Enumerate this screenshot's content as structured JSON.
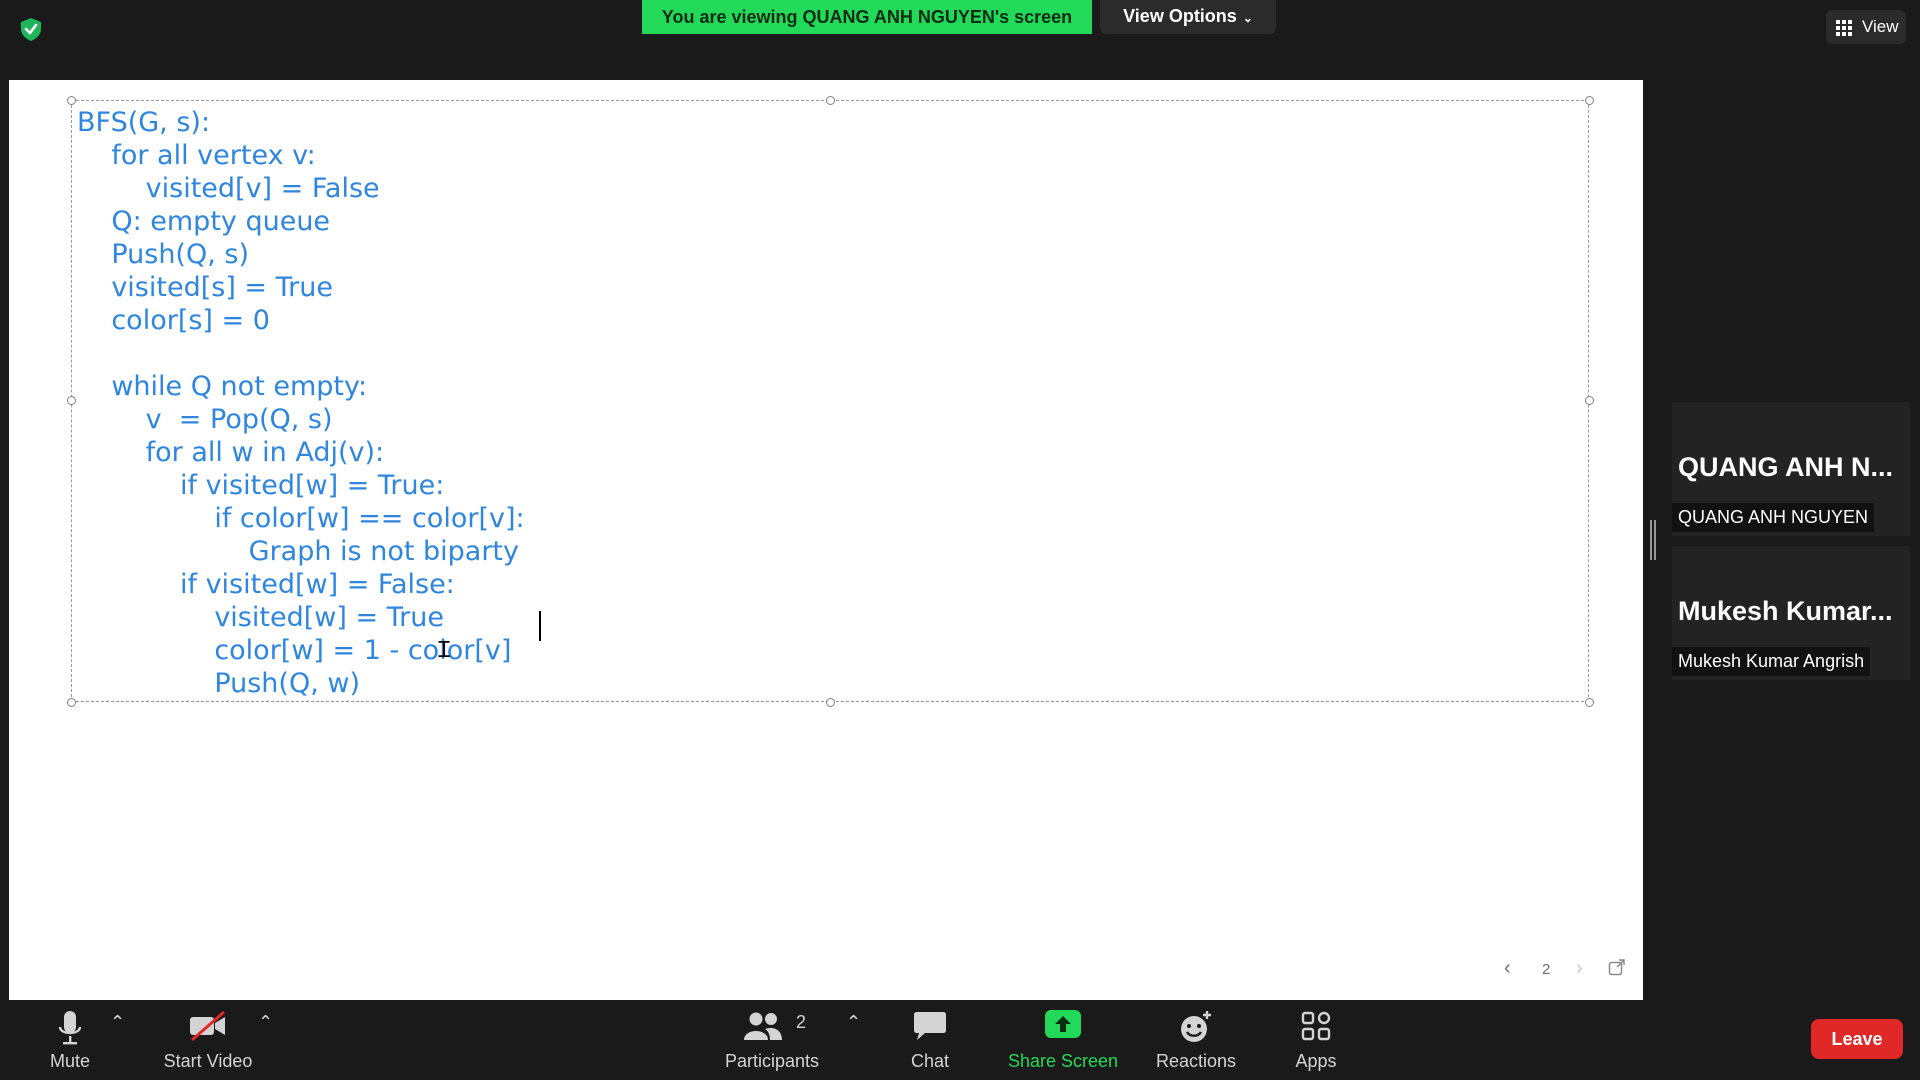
{
  "top_bar": {
    "banner": "You are viewing QUANG ANH NGUYEN's screen",
    "view_options_label": "View Options",
    "view_label": "View"
  },
  "shared_screen": {
    "code_lines": [
      "BFS(G, s):",
      "    for all vertex v:",
      "        visited[v] = False",
      "    Q: empty queue",
      "    Push(Q, s)",
      "    visited[s] = True",
      "    color[s] = 0",
      "",
      "    while Q not empty:",
      "        v  = Pop(Q, s)",
      "        for all w in Adj(v):",
      "            if visited[w] = True:",
      "                if color[w] == color[v]:",
      "                    Graph is not biparty",
      "            if visited[w] = False:",
      "                visited[w] = True",
      "                color[w] = 1 - color[v]",
      "                Push(Q, w)"
    ],
    "page_number": "2"
  },
  "participants": [
    {
      "display_name": "QUANG ANH N...",
      "full_name": "QUANG ANH NGUYEN"
    },
    {
      "display_name": "Mukesh  Kumar...",
      "full_name": "Mukesh Kumar Angrish"
    }
  ],
  "toolbar": {
    "mute_label": "Mute",
    "start_video_label": "Start Video",
    "participants_label": "Participants",
    "participants_count": "2",
    "chat_label": "Chat",
    "share_screen_label": "Share Screen",
    "reactions_label": "Reactions",
    "apps_label": "Apps",
    "leave_label": "Leave"
  },
  "colors": {
    "banner_green": "#23d959",
    "code_blue": "#2f86de",
    "share_green": "#23d959",
    "leave_red": "#e02828"
  }
}
